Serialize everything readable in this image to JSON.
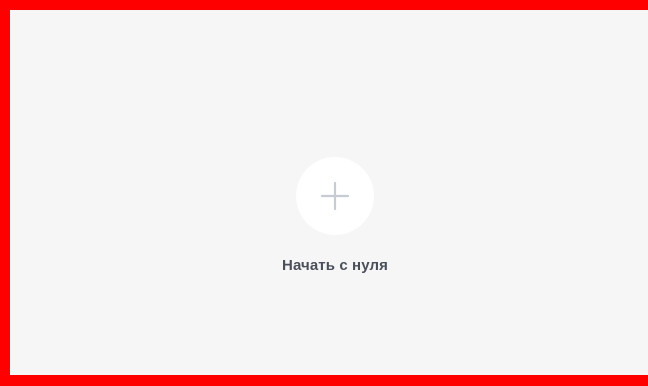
{
  "start_card": {
    "label": "Начать с нуля",
    "icon": "plus-icon"
  },
  "colors": {
    "frame_border": "#ff0000",
    "panel_bg": "#f6f6f6",
    "circle_bg": "#ffffff",
    "plus_icon": "#c7cbd3",
    "label_text": "#4a4f5a"
  }
}
